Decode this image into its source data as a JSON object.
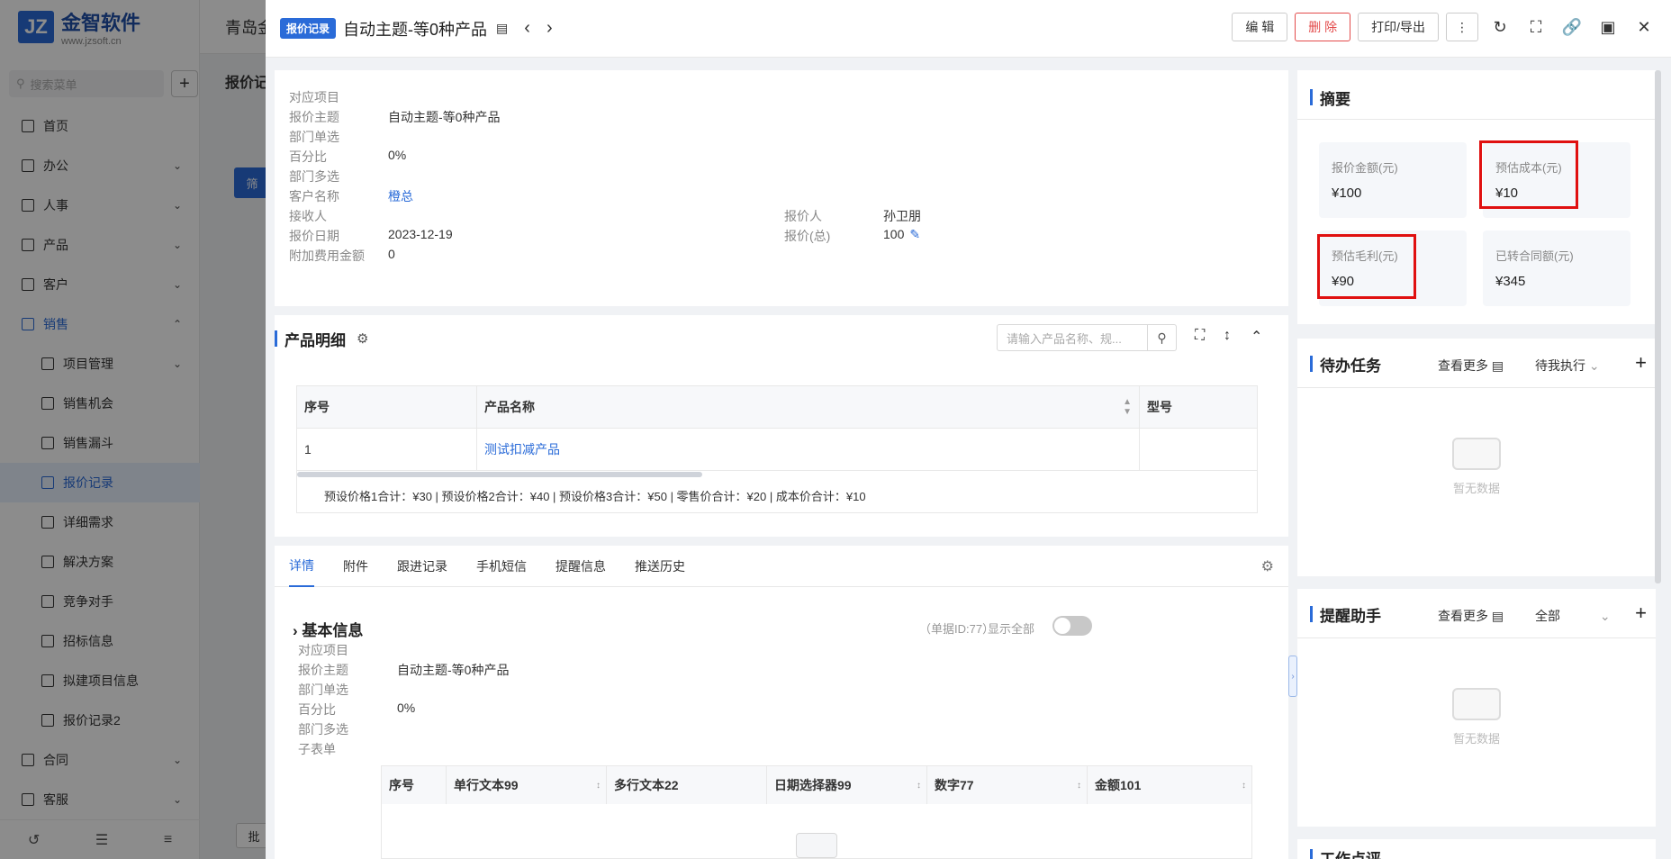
{
  "sidebar": {
    "logo_mark": "JZ",
    "logo_title": "金智软件",
    "logo_sub": "www.jzsoft.cn",
    "search_placeholder": "搜索菜单",
    "items": [
      {
        "label": "首页"
      },
      {
        "label": "办公"
      },
      {
        "label": "人事"
      },
      {
        "label": "产品"
      },
      {
        "label": "客户"
      },
      {
        "label": "销售"
      },
      {
        "label": "项目管理"
      },
      {
        "label": "销售机会"
      },
      {
        "label": "销售漏斗"
      },
      {
        "label": "报价记录"
      },
      {
        "label": "详细需求"
      },
      {
        "label": "解决方案"
      },
      {
        "label": "竞争对手"
      },
      {
        "label": "招标信息"
      },
      {
        "label": "拟建项目信息"
      },
      {
        "label": "报价记录2"
      },
      {
        "label": "合同"
      },
      {
        "label": "客服"
      }
    ]
  },
  "background": {
    "top_title": "青岛金",
    "page_title": "报价记",
    "filter_label": "筛",
    "batch_label": "批"
  },
  "drawer": {
    "tag": "报价记录",
    "title": "自动主题-等0种产品",
    "buttons": {
      "edit": "编 辑",
      "delete": "删 除",
      "print": "打印/导出"
    },
    "fields": [
      {
        "label": "对应项目",
        "value": ""
      },
      {
        "label": "报价主题",
        "value": "自动主题-等0种产品"
      },
      {
        "label": "部门单选",
        "value": ""
      },
      {
        "label": "百分比",
        "value": "0%"
      },
      {
        "label": "部门多选",
        "value": ""
      },
      {
        "label": "客户名称",
        "value": "橙总"
      },
      {
        "label": "接收人",
        "value": ""
      },
      {
        "label": "报价日期",
        "value": "2023-12-19"
      },
      {
        "label": "附加费用金额",
        "value": "0"
      },
      {
        "label": "报价人",
        "value": "孙卫朋"
      },
      {
        "label": "报价(总)",
        "value": "100"
      }
    ],
    "products": {
      "title": "产品明细",
      "search_placeholder": "请输入产品名称、规...",
      "columns": [
        "序号",
        "产品名称",
        "型号"
      ],
      "rows": [
        {
          "no": "1",
          "name": "测试扣减产品",
          "model": ""
        }
      ],
      "summary": "预设价格1合计：¥30 |   预设价格2合计：¥40 |   预设价格3合计：¥50 |   零售价合计：¥20 |   成本价合计：¥10"
    },
    "tabs": [
      "详情",
      "附件",
      "跟进记录",
      "手机短信",
      "提醒信息",
      "推送历史"
    ],
    "basic": {
      "title": "基本信息",
      "doc_id": "（单据ID:77）",
      "show_all": "显示全部",
      "fields": [
        {
          "label": "对应项目",
          "value": ""
        },
        {
          "label": "报价主题",
          "value": "自动主题-等0种产品"
        },
        {
          "label": "部门单选",
          "value": ""
        },
        {
          "label": "百分比",
          "value": "0%"
        },
        {
          "label": "部门多选",
          "value": ""
        },
        {
          "label": "子表单",
          "value": ""
        }
      ],
      "sub_columns": [
        "序号",
        "单行文本99",
        "多行文本22",
        "日期选择器99",
        "数字77",
        "金额101"
      ]
    }
  },
  "right": {
    "summary_title": "摘要",
    "stats": [
      {
        "label": "报价金额(元)",
        "value": "¥100"
      },
      {
        "label": "预估成本(元)",
        "value": "¥10"
      },
      {
        "label": "预估毛利(元)",
        "value": "¥90"
      },
      {
        "label": "已转合同额(元)",
        "value": "¥345"
      }
    ],
    "todo": {
      "title": "待办任务",
      "more": "查看更多",
      "filter": "待我执行",
      "empty": "暂无数据"
    },
    "reminder": {
      "title": "提醒助手",
      "more": "查看更多",
      "filter": "全部",
      "empty": "暂无数据"
    },
    "bottom_title": "工作点评"
  },
  "colors": {
    "accent": "#2a6bd8",
    "danger": "#e34b4b",
    "highlight": "#e01010"
  }
}
